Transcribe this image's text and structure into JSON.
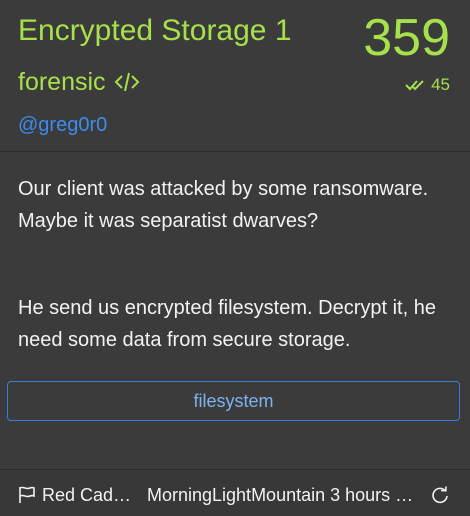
{
  "challenge": {
    "title": "Encrypted Storage 1",
    "score": "359",
    "category": "forensic",
    "solves": "45",
    "author": "@greg0r0"
  },
  "description": {
    "paragraph1": "Our client was attacked by some ransomware. Maybe it was separatist dwarves?",
    "paragraph2": "He send us encrypted filesystem. Decrypt it, he need some data from secure storage."
  },
  "tags": [
    {
      "label": "filesystem"
    }
  ],
  "footer": {
    "team": "Red Cad…",
    "solver": "MorningLightMountain 3 hours …"
  },
  "colors": {
    "accent_green": "#a6e04a",
    "link_blue": "#3c8cf0",
    "background": "#3b3b3b"
  },
  "icons": {
    "category": "code-icon",
    "solves": "double-check-icon",
    "footer_left": "flag-icon",
    "footer_right": "refresh-icon"
  }
}
